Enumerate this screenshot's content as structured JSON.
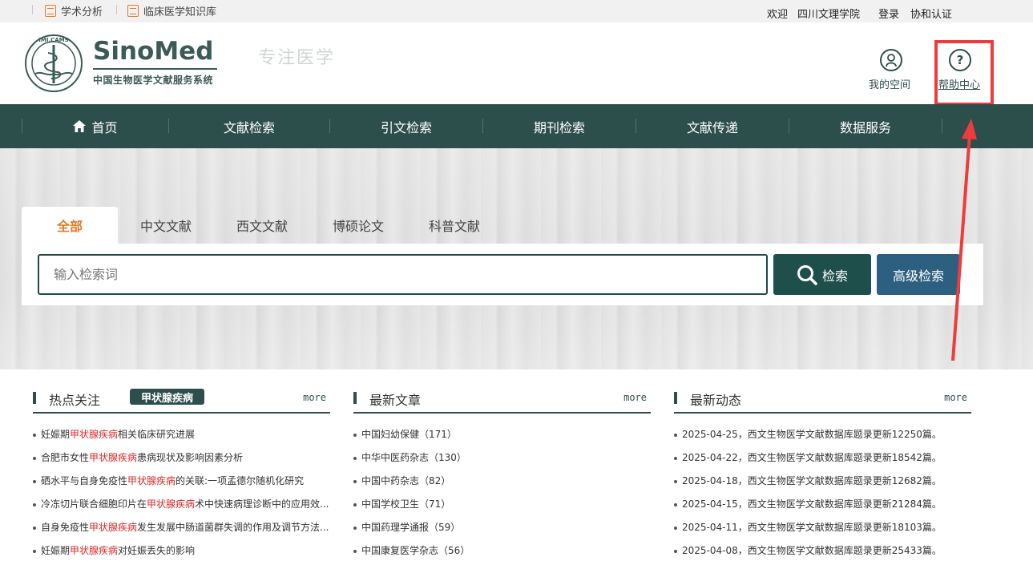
{
  "topbar": {
    "link1": "学术分析",
    "link2": "临床医学知识库",
    "welcome": "欢迎",
    "institution": "四川文理学院",
    "login": "登录",
    "auth": "协和认证"
  },
  "header": {
    "brand": "SinoMed",
    "brand_sub": "中国生物医学文献服务系统",
    "emblem_text": "IMI.CAMS",
    "slogan": "专注医学",
    "my_space": "我的空间",
    "help_center": "帮助中心"
  },
  "nav": {
    "items": [
      "首页",
      "文献检索",
      "引文检索",
      "期刊检索",
      "文献传递",
      "数据服务"
    ]
  },
  "search": {
    "tabs": [
      "全部",
      "中文文献",
      "西文文献",
      "博硕论文",
      "科普文献"
    ],
    "placeholder": "输入检索词",
    "search_label": "检索",
    "advanced_label": "高级检索"
  },
  "hot": {
    "title": "热点关注",
    "tag": "甲状腺疾病",
    "more": "more",
    "items": [
      {
        "pre": "妊娠期",
        "hl": "甲状腺疾病",
        "post": "相关临床研究进展"
      },
      {
        "pre": "合肥市女性",
        "hl": "甲状腺疾病",
        "post": "患病现状及影响因素分析"
      },
      {
        "pre": "硒水平与自身免疫性",
        "hl": "甲状腺疾病",
        "post": "的关联:一项孟德尔随机化研究"
      },
      {
        "pre": "冷冻切片联合细胞印片在",
        "hl": "甲状腺疾病",
        "post": "术中快速病理诊断中的应用效..."
      },
      {
        "pre": "自身免疫性",
        "hl": "甲状腺疾病",
        "post": "发生发展中肠道菌群失调的作用及调节方法..."
      },
      {
        "pre": "妊娠期",
        "hl": "甲状腺疾病",
        "post": "对妊娠丢失的影响"
      }
    ]
  },
  "articles": {
    "title": "最新文章",
    "more": "more",
    "items": [
      "中国妇幼保健（171）",
      "中华中医药杂志（130）",
      "中国中药杂志（82）",
      "中国学校卫生（71）",
      "中国药理学通报（59）",
      "中国康复医学杂志（56）"
    ]
  },
  "news": {
    "title": "最新动态",
    "more": "more",
    "items": [
      "2025-04-25，西文生物医学文献数据库题录更新12250篇。",
      "2025-04-22，西文生物医学文献数据库题录更新18542篇。",
      "2025-04-18，西文生物医学文献数据库题录更新12682篇。",
      "2025-04-15，西文生物医学文献数据库题录更新21284篇。",
      "2025-04-11，西文生物医学文献数据库题录更新18103篇。",
      "2025-04-08，西文生物医学文献数据库题录更新25433篇。"
    ]
  },
  "colors": {
    "primary": "#2d4f4b",
    "accent": "#e07a2a",
    "highlight": "#d92b2b",
    "annotation": "#ee3b3b",
    "advanced": "#2d5f80"
  }
}
